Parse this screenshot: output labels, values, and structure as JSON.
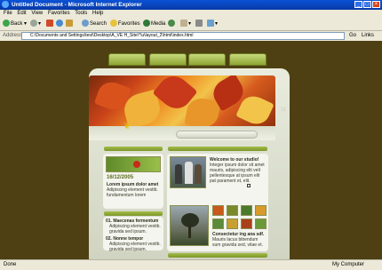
{
  "window": {
    "title": "Untitled Document - Microsoft Internet Explorer",
    "controls": {
      "minimize": "_",
      "maximize": "□",
      "close": "×"
    }
  },
  "menu": [
    "File",
    "Edit",
    "View",
    "Favorites",
    "Tools",
    "Help"
  ],
  "toolbar": {
    "back": "Back",
    "search": "Search",
    "favorites": "Favorites",
    "media": "Media"
  },
  "address": {
    "label": "Address",
    "value": "C:\\Documents and Settings\\test\\Desktop\\A_VE H_Site\\*\\u\\layout_2\\html\\index.html",
    "go": "Go",
    "links": "Links"
  },
  "site": {
    "side_label": "15",
    "news1": {
      "date": "16/12/2005",
      "title": "Lorem ipsum dolor amet",
      "text1": "Adipiscing element vestib.",
      "text2": "fundamentum lorem"
    },
    "welcome": {
      "title": "Welcome to our studio!",
      "text1": "Integer ipsum dolor sit amet",
      "text2": "mauris, adipiscing elit velt",
      "text3": "pellentesque at ipsum elit",
      "text4": "pat parament et, elit."
    },
    "list": {
      "item1_title": "01. Maecenas fermentum",
      "item1_text1": "Adipiscing element vestib.",
      "item1_text2": "gravida sed ipsum.",
      "item2_title": "02. Nonne tempor",
      "item2_text1": "Adipiscing element vestib.",
      "item2_text2": "gravida sed ipsum."
    },
    "comment": {
      "title": "Consectetur ing ana sdf.",
      "text1": "Mauris lacus bibendum",
      "text2": "sum gravida sed, vitae et."
    }
  },
  "status": {
    "left": "Done",
    "right": "My Computer"
  },
  "colors": {
    "page_bg": "#4e4013",
    "accent_green": "#8ea633",
    "frame": "#e9ecdd"
  }
}
